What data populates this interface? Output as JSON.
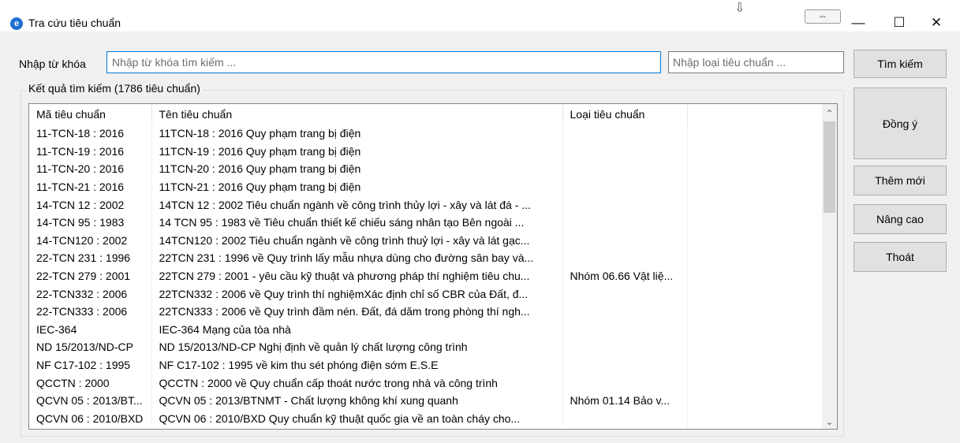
{
  "window": {
    "title": "Tra cứu tiêu chuẩn",
    "app_icon": "app-logo-icon",
    "controls": {
      "minimize": "—",
      "maximize": "☐",
      "close": "✕"
    }
  },
  "search": {
    "keyword_label": "Nhập từ khóa",
    "keyword_placeholder": "Nhập từ khóa tìm kiếm ...",
    "keyword_value": "",
    "type_placeholder": "Nhập loại tiêu chuẩn ...",
    "type_value": ""
  },
  "buttons": {
    "search": "Tìm kiếm",
    "ok": "Đồng ý",
    "add": "Thêm mới",
    "advanced": "Nâng cao",
    "exit": "Thoát"
  },
  "results": {
    "group_title": "Kết quả tìm kiếm (1786 tiêu chuẩn)",
    "columns": [
      "Mã tiêu chuẩn",
      "Tên tiêu chuẩn",
      "Loại tiêu chuẩn",
      ""
    ],
    "rows": [
      [
        "11-TCN-18 : 2016",
        "11TCN-18 : 2016 Quy phạm trang bị điện",
        "",
        ""
      ],
      [
        "11-TCN-19 : 2016",
        "11TCN-19 : 2016 Quy phạm trang bị điện",
        "",
        ""
      ],
      [
        "11-TCN-20 : 2016",
        "11TCN-20 : 2016 Quy phạm trang bị điện",
        "",
        ""
      ],
      [
        "11-TCN-21 : 2016",
        "11TCN-21 : 2016 Quy phạm trang bị điện",
        "",
        ""
      ],
      [
        "14-TCN 12 : 2002",
        "14TCN 12 : 2002 Tiêu chuẩn ngành về công trình thủy lợi - xây và lát đá - ...",
        "",
        ""
      ],
      [
        "14-TCN 95 : 1983",
        "14 TCN 95 : 1983 về Tiêu chuẩn thiết kế chiếu sáng nhân tạo Bên ngoài ...",
        "",
        ""
      ],
      [
        "14-TCN120 : 2002",
        "14TCN120 : 2002 Tiêu chuẩn ngành về công trình thuỷ lợi - xây và lát gạc...",
        "",
        ""
      ],
      [
        "22-TCN 231 : 1996",
        "22TCN 231 : 1996 về Quy trình lấy mẫu nhựa dùng cho đường sân bay và...",
        "",
        ""
      ],
      [
        "22-TCN 279 : 2001",
        "22TCN 279 : 2001 - yêu cầu kỹ thuật và phương pháp thí nghiệm tiêu chu...",
        "Nhóm 06.66 Vật liệ...",
        ""
      ],
      [
        "22-TCN332 : 2006",
        "22TCN332 : 2006 về Quy trình thí nghiệmXác định chỉ số CBR của Đất, đ...",
        "",
        ""
      ],
      [
        "22-TCN333 : 2006",
        "22TCN333 : 2006 về Quy trình đầm nén. Đất, đá dăm trong phòng thí ngh...",
        "",
        ""
      ],
      [
        "IEC-364",
        "IEC-364 Mạng của tòa nhà",
        "",
        ""
      ],
      [
        "ND 15/2013/ND-CP",
        "ND 15/2013/ND-CP Nghị định về quản lý chất lượng công trình",
        "",
        ""
      ],
      [
        "NF C17-102 : 1995",
        "NF C17-102 : 1995 về kim thu sét phóng điện sớm E.S.E",
        "",
        ""
      ],
      [
        "QCCTN : 2000",
        "QCCTN : 2000 về Quy chuẩn cấp thoát nước trong nhà và công trình",
        "",
        ""
      ],
      [
        "QCVN 05 : 2013/BT...",
        "QCVN 05 : 2013/BTNMT - Chất lượng không khí xung quanh",
        "Nhóm 01.14 Bảo v...",
        ""
      ],
      [
        "QCVN 06 : 2010/BXD",
        "QCVN 06 : 2010/BXD Quy chuẩn kỹ thuật quốc gia về an toàn cháy cho...",
        "",
        ""
      ]
    ]
  },
  "scrollbar": {
    "up_arrow": "⌃",
    "down_arrow": "⌄",
    "position_fraction": 0.0
  }
}
